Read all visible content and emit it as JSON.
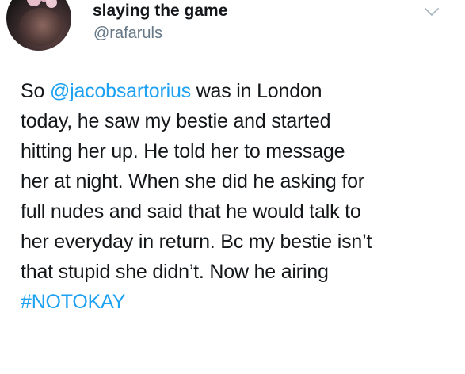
{
  "profile": {
    "display_name": "slaying the game",
    "handle": "@rafaruls"
  },
  "menu": {
    "icon": "chevron-down-icon"
  },
  "tweet": {
    "line1_pre": "So ",
    "mention": "@jacobsartorius",
    "line1_post": " was in London",
    "line2": "today, he saw my bestie and started",
    "line3": "hitting her up. He told her to message",
    "line4": "her at night. When she did he asking for",
    "line5": "full nudes and said that he would talk to",
    "line6": "her everyday in return. Bc my bestie isn’t",
    "line7": "that stupid she didn’t. Now he airing",
    "hashtag": "#NOTOKAY"
  },
  "colors": {
    "text": "#14171a",
    "secondary_text": "#657786",
    "link": "#1da1f2",
    "background": "#ffffff"
  }
}
